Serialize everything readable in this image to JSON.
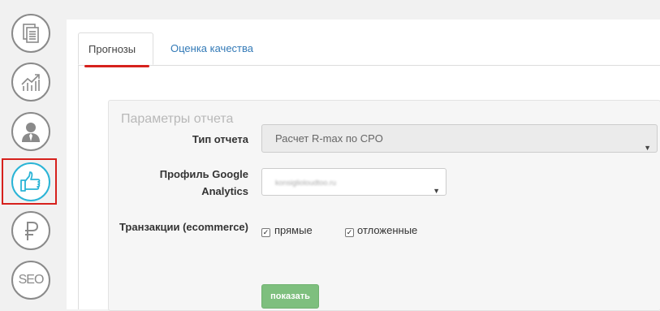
{
  "sidebar": {
    "items": [
      {
        "icon": "documents-icon"
      },
      {
        "icon": "chart-growth-icon"
      },
      {
        "icon": "user-icon"
      },
      {
        "icon": "thumbs-up-icon",
        "active": true
      },
      {
        "icon": "ruble-icon"
      },
      {
        "icon": "seo-icon",
        "text": "SEO"
      }
    ]
  },
  "tabs": [
    {
      "label": "Прогнозы",
      "active": true
    },
    {
      "label": "Оценка качества",
      "active": false
    }
  ],
  "form": {
    "legend": "Параметры отчета",
    "report_type": {
      "label": "Тип отчета",
      "value": "Расчет R-max по CPO"
    },
    "profile": {
      "label": "Профиль Google Analytics",
      "value": "konsiglioloudtoo.ru"
    },
    "transactions": {
      "label": "Транзакции (ecommerce)",
      "options": [
        {
          "label": "прямые",
          "checked": true
        },
        {
          "label": "отложенные",
          "checked": true
        }
      ]
    },
    "submit_label": "показать"
  },
  "colors": {
    "active_accent": "#2ab4d6",
    "highlight_red": "#d6211d",
    "link_blue": "#337ab7",
    "button_green": "#7ebf7e"
  }
}
